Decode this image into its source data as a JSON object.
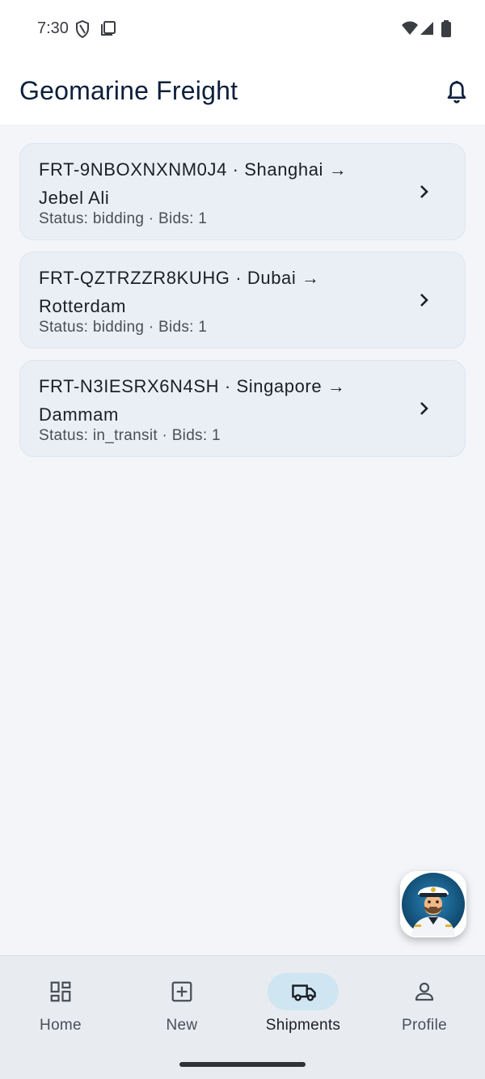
{
  "status_bar": {
    "time": "7:30"
  },
  "app": {
    "title": "Geomarine Freight"
  },
  "shipments": [
    {
      "id": "FRT-9NBOXNXNM0J4",
      "origin": "Shanghai",
      "destination": "Jebel Ali",
      "title": "FRT-9NBOXNXNM0J4  ·  Shanghai → Jebel Ali",
      "subtitle": "Status: bidding  ·  Bids: 1"
    },
    {
      "id": "FRT-QZTRZZR8KUHG",
      "origin": "Dubai",
      "destination": "Rotterdam",
      "title": "FRT-QZTRZZR8KUHG  ·  Dubai → Rotterdam",
      "subtitle": "Status: bidding  ·  Bids: 1"
    },
    {
      "id": "FRT-N3IESRX6N4SH",
      "origin": "Singapore",
      "destination": "Dammam",
      "title": "FRT-N3IESRX6N4SH  ·  Singapore → Dammam",
      "subtitle": "Status: in_transit  ·  Bids: 1"
    }
  ],
  "fab": {
    "icon": "captain-avatar-icon"
  },
  "nav": {
    "items": [
      {
        "label": "Home",
        "icon": "dashboard-icon"
      },
      {
        "label": "New",
        "icon": "add-box-icon"
      },
      {
        "label": "Shipments",
        "icon": "truck-icon",
        "active": true
      },
      {
        "label": "Profile",
        "icon": "person-icon"
      }
    ]
  },
  "colors": {
    "accent": "#cfe5f1",
    "title": "#0d1f3c",
    "card": "#e9eff5",
    "background": "#f3f5f9"
  }
}
